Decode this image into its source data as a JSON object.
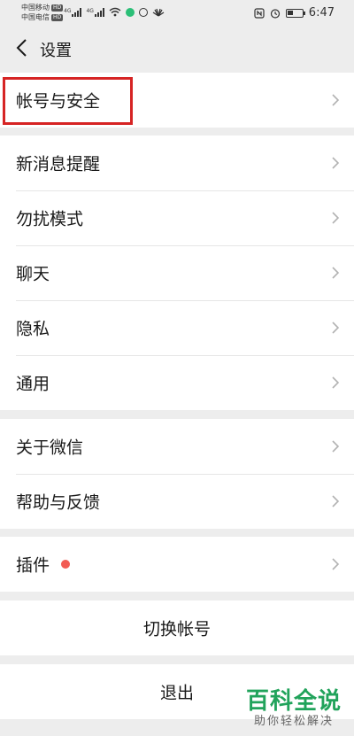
{
  "status_bar": {
    "carrier_1": "中国移动",
    "carrier_2": "中国电信",
    "hd_badge": "HD",
    "net_type": "4G",
    "time": "6:47"
  },
  "nav": {
    "title": "设置"
  },
  "groups": {
    "account": {
      "items": [
        {
          "label": "帐号与安全"
        }
      ]
    },
    "main": {
      "items": [
        {
          "label": "新消息提醒"
        },
        {
          "label": "勿扰模式"
        },
        {
          "label": "聊天"
        },
        {
          "label": "隐私"
        },
        {
          "label": "通用"
        }
      ]
    },
    "about": {
      "items": [
        {
          "label": "关于微信"
        },
        {
          "label": "帮助与反馈"
        }
      ]
    },
    "plugins": {
      "items": [
        {
          "label": "插件"
        }
      ]
    }
  },
  "switch_account": {
    "label": "切换帐号"
  },
  "logout": {
    "label": "退出"
  },
  "watermark": {
    "title": "百科全说",
    "subtitle": "助你轻松解决"
  },
  "colors": {
    "background": "#ededed",
    "highlight": "#d62424",
    "badge": "#f25c54",
    "watermark": "#21a35b"
  }
}
